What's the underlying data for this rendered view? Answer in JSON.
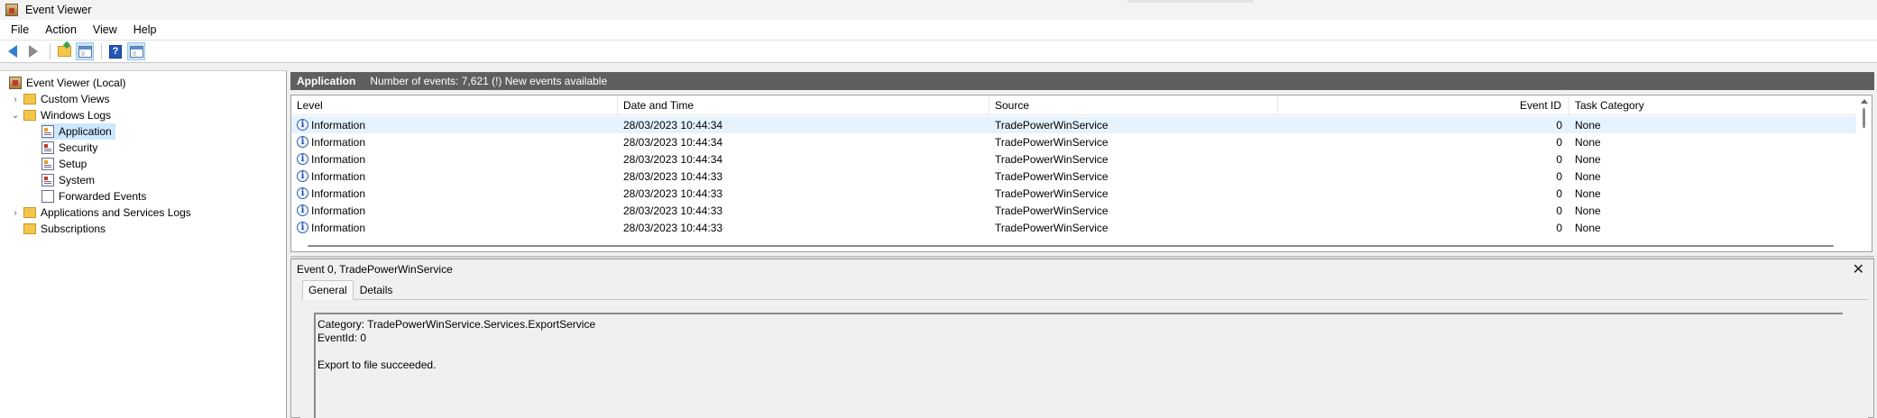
{
  "window": {
    "title": "Event Viewer"
  },
  "menu": [
    "File",
    "Action",
    "View",
    "Help"
  ],
  "toolbar": {
    "buttons": [
      "back-icon",
      "forward-icon",
      "up-folder-icon",
      "show-hide-console-tree-icon",
      "help-icon",
      "show-hide-action-pane-icon"
    ]
  },
  "tree": {
    "root": "Event Viewer (Local)",
    "custom_views": "Custom Views",
    "windows_logs": "Windows Logs",
    "application": "Application",
    "security": "Security",
    "setup": "Setup",
    "system": "System",
    "forwarded_events": "Forwarded Events",
    "apps_services_logs": "Applications and Services Logs",
    "subscriptions": "Subscriptions"
  },
  "log_header": {
    "name": "Application",
    "info": "Number of events: 7,621 (!) New events available"
  },
  "grid": {
    "columns": [
      "Level",
      "Date and Time",
      "Source",
      "Event ID",
      "Task Category"
    ],
    "rows": [
      {
        "level": "Information",
        "datetime": "28/03/2023 10:44:34",
        "source": "TradePowerWinService",
        "event_id": "0",
        "task": "None"
      },
      {
        "level": "Information",
        "datetime": "28/03/2023 10:44:34",
        "source": "TradePowerWinService",
        "event_id": "0",
        "task": "None"
      },
      {
        "level": "Information",
        "datetime": "28/03/2023 10:44:34",
        "source": "TradePowerWinService",
        "event_id": "0",
        "task": "None"
      },
      {
        "level": "Information",
        "datetime": "28/03/2023 10:44:33",
        "source": "TradePowerWinService",
        "event_id": "0",
        "task": "None"
      },
      {
        "level": "Information",
        "datetime": "28/03/2023 10:44:33",
        "source": "TradePowerWinService",
        "event_id": "0",
        "task": "None"
      },
      {
        "level": "Information",
        "datetime": "28/03/2023 10:44:33",
        "source": "TradePowerWinService",
        "event_id": "0",
        "task": "None"
      },
      {
        "level": "Information",
        "datetime": "28/03/2023 10:44:33",
        "source": "TradePowerWinService",
        "event_id": "0",
        "task": "None"
      }
    ]
  },
  "detail": {
    "title": "Event 0, TradePowerWinService",
    "tabs": [
      "General",
      "Details"
    ],
    "lines": [
      "Category: TradePowerWinService.Services.ExportService",
      "EventId: 0",
      "",
      "Export to file succeeded."
    ]
  },
  "colors": {
    "header_strip": "#5f5f5f",
    "selected": "#cce8ff",
    "hover_row": "#e5f3ff"
  }
}
